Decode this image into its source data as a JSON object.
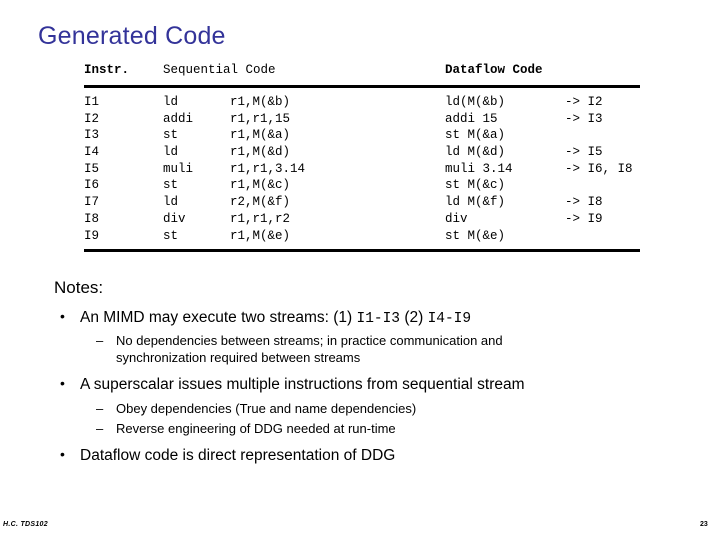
{
  "slide": {
    "title": "Generated Code",
    "notes_heading": "Notes:"
  },
  "table": {
    "headers": {
      "instr": "Instr.",
      "sequential": "Sequential Code",
      "dataflow": "Dataflow Code"
    },
    "rows": [
      {
        "instr": "I1",
        "op": "ld",
        "args": "r1,M(&b)",
        "dataflow": "ld(M(&b)",
        "arrow": "-> I2"
      },
      {
        "instr": "I2",
        "op": "addi",
        "args": "r1,r1,15",
        "dataflow": "addi 15",
        "arrow": "-> I3"
      },
      {
        "instr": "I3",
        "op": "st",
        "args": "r1,M(&a)",
        "dataflow": "st M(&a)",
        "arrow": ""
      },
      {
        "instr": "I4",
        "op": "ld",
        "args": "r1,M(&d)",
        "dataflow": "ld M(&d)",
        "arrow": "-> I5"
      },
      {
        "instr": "I5",
        "op": "muli",
        "args": "r1,r1,3.14",
        "dataflow": "muli 3.14",
        "arrow": "-> I6, I8"
      },
      {
        "instr": "I6",
        "op": "st",
        "args": "r1,M(&c)",
        "dataflow": "st M(&c)",
        "arrow": ""
      },
      {
        "instr": "I7",
        "op": "ld",
        "args": "r2,M(&f)",
        "dataflow": "ld M(&f)",
        "arrow": "-> I8"
      },
      {
        "instr": "I8",
        "op": "div",
        "args": "r1,r1,r2",
        "dataflow": "div",
        "arrow": "-> I9"
      },
      {
        "instr": "I9",
        "op": "st",
        "args": "r1,M(&e)",
        "dataflow": "st M(&e)",
        "arrow": ""
      }
    ]
  },
  "notes": {
    "bullet1_pre": "An MIMD may execute two streams: (1) ",
    "bullet1_mono1": "I1-I3",
    "bullet1_mid": "  (2) ",
    "bullet1_mono2": "I4-I9",
    "sub1_line1": "No dependencies between streams; in practice communication and",
    "sub1_line2": "synchronization  required between streams",
    "bullet2": "A superscalar issues multiple instructions from sequential stream",
    "sub2a": "Obey dependencies (True and name dependencies)",
    "sub2b": "Reverse engineering of DDG needed at run-time",
    "bullet3": "Dataflow code is direct representation of DDG"
  },
  "footer": {
    "left": "H.C. TDS102",
    "page": "23"
  },
  "colors": {
    "title": "#333399",
    "text": "#000000",
    "background": "#ffffff"
  }
}
